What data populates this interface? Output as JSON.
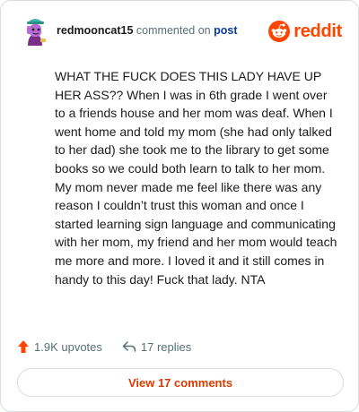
{
  "header": {
    "username": "redmooncat15",
    "action": " commented on ",
    "post_link": "post",
    "brand": "reddit",
    "avatar_icon": "snoo-avatar-icon",
    "logo_icon": "reddit-snoo-icon"
  },
  "comment": {
    "text": "WHAT THE FUCK DOES THIS LADY HAVE UP HER ASS?? When I was in 6th grade I went over to a friends house and her mom was deaf. When I went home and told my mom (she had only talked to her dad) she took me to the library to get some books so we could both learn to talk to her mom. My mom never made me feel like there was any reason I couldn’t trust this woman and once I started learning sign language and communicating with her mom, my friend and her mom would teach me more and more. I loved it and it still comes in handy to this day! Fuck that lady. NTA"
  },
  "footer": {
    "upvotes": "1.9K upvotes",
    "replies": "17 replies",
    "upvote_icon": "upvote-arrow-icon",
    "reply_icon": "reply-arrow-icon"
  },
  "actions": {
    "view_comments": "View 17 comments"
  },
  "colors": {
    "brand": "#ff4500",
    "link": "#0a3a9c",
    "muted": "#576f76",
    "button_text": "#d93a00"
  }
}
